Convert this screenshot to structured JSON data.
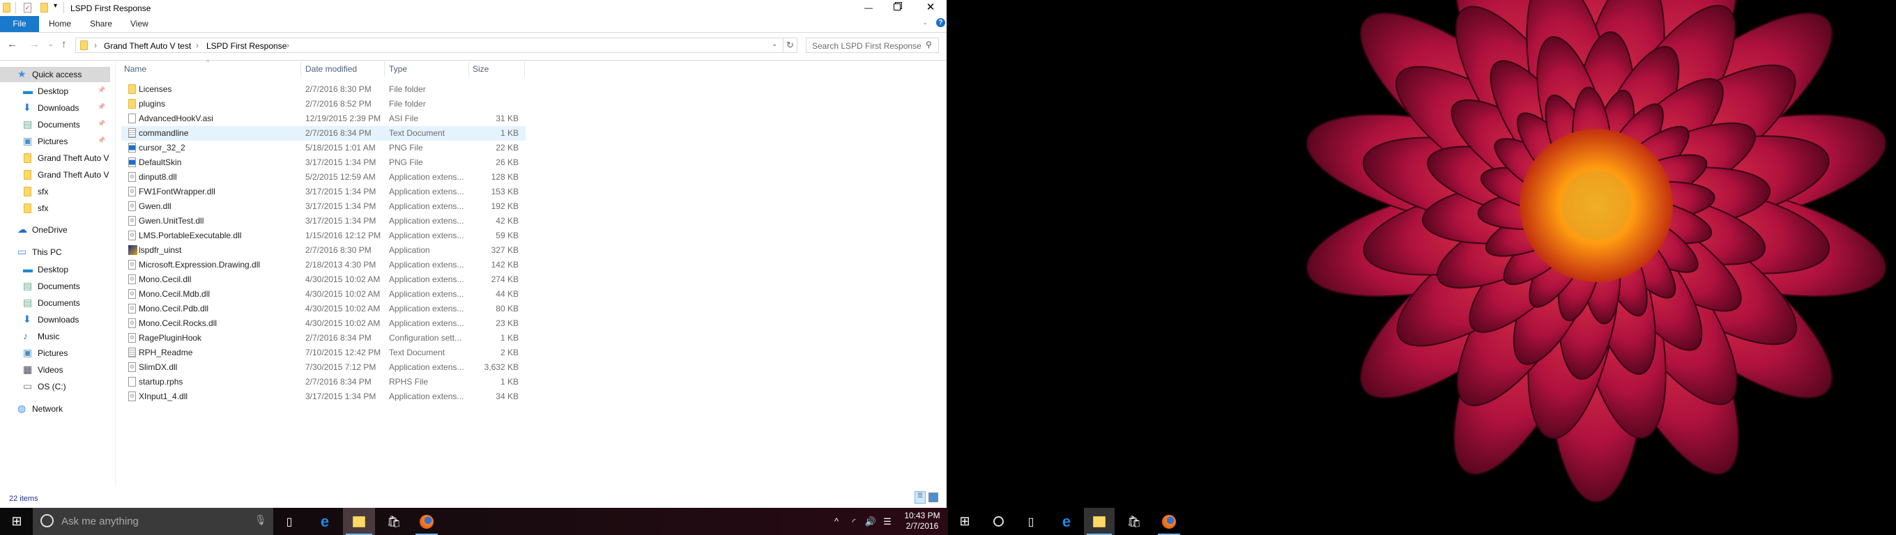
{
  "window": {
    "title": "LSPD First Response"
  },
  "ribbon": {
    "tabs": [
      "File",
      "Home",
      "Share",
      "View"
    ]
  },
  "address": {
    "crumbs": [
      "Grand Theft Auto V test",
      "LSPD First Response"
    ],
    "search_placeholder": "Search LSPD First Response"
  },
  "columns": {
    "name": "Name",
    "date": "Date modified",
    "type": "Type",
    "size": "Size"
  },
  "nav": {
    "quick_access": "Quick access",
    "quick_items": [
      {
        "label": "Desktop",
        "icon": "desktop-icon"
      },
      {
        "label": "Downloads",
        "icon": "download-icon"
      },
      {
        "label": "Documents",
        "icon": "documents-icon"
      },
      {
        "label": "Pictures",
        "icon": "pictures-icon"
      },
      {
        "label": "Grand Theft Auto V",
        "icon": "folder-icon"
      },
      {
        "label": "Grand Theft Auto V",
        "icon": "folder-icon"
      },
      {
        "label": "sfx",
        "icon": "folder-icon"
      },
      {
        "label": "sfx",
        "icon": "folder-icon"
      }
    ],
    "onedrive": "OneDrive",
    "this_pc": "This PC",
    "pc_items": [
      {
        "label": "Desktop",
        "icon": "desktop-icon"
      },
      {
        "label": "Documents",
        "icon": "documents-icon"
      },
      {
        "label": "Documents",
        "icon": "documents-icon"
      },
      {
        "label": "Downloads",
        "icon": "download-icon"
      },
      {
        "label": "Music",
        "icon": "music-icon"
      },
      {
        "label": "Pictures",
        "icon": "pictures-icon"
      },
      {
        "label": "Videos",
        "icon": "videos-icon"
      },
      {
        "label": "OS (C:)",
        "icon": "drive-icon"
      }
    ],
    "network": "Network"
  },
  "files": [
    {
      "name": "Licenses",
      "date": "2/7/2016 8:30 PM",
      "type": "File folder",
      "size": "",
      "icon": "folder"
    },
    {
      "name": "plugins",
      "date": "2/7/2016 8:52 PM",
      "type": "File folder",
      "size": "",
      "icon": "folder"
    },
    {
      "name": "AdvancedHookV.asi",
      "date": "12/19/2015 2:39 PM",
      "type": "ASI File",
      "size": "31 KB",
      "icon": "file"
    },
    {
      "name": "commandline",
      "date": "2/7/2016 8:34 PM",
      "type": "Text Document",
      "size": "1 KB",
      "icon": "text"
    },
    {
      "name": "cursor_32_2",
      "date": "5/18/2015 1:01 AM",
      "type": "PNG File",
      "size": "22 KB",
      "icon": "image"
    },
    {
      "name": "DefaultSkin",
      "date": "3/17/2015 1:34 PM",
      "type": "PNG File",
      "size": "26 KB",
      "icon": "image"
    },
    {
      "name": "dinput8.dll",
      "date": "5/2/2015 12:59 AM",
      "type": "Application extens...",
      "size": "128 KB",
      "icon": "dll"
    },
    {
      "name": "FW1FontWrapper.dll",
      "date": "3/17/2015 1:34 PM",
      "type": "Application extens...",
      "size": "153 KB",
      "icon": "dll"
    },
    {
      "name": "Gwen.dll",
      "date": "3/17/2015 1:34 PM",
      "type": "Application extens...",
      "size": "192 KB",
      "icon": "dll"
    },
    {
      "name": "Gwen.UnitTest.dll",
      "date": "3/17/2015 1:34 PM",
      "type": "Application extens...",
      "size": "42 KB",
      "icon": "dll"
    },
    {
      "name": "LMS.PortableExecutable.dll",
      "date": "1/15/2016 12:12 PM",
      "type": "Application extens...",
      "size": "59 KB",
      "icon": "dll"
    },
    {
      "name": "lspdfr_uinst",
      "date": "2/7/2016 8:30 PM",
      "type": "Application",
      "size": "327 KB",
      "icon": "app"
    },
    {
      "name": "Microsoft.Expression.Drawing.dll",
      "date": "2/18/2013 4:30 PM",
      "type": "Application extens...",
      "size": "142 KB",
      "icon": "dll"
    },
    {
      "name": "Mono.Cecil.dll",
      "date": "4/30/2015 10:02 AM",
      "type": "Application extens...",
      "size": "274 KB",
      "icon": "dll"
    },
    {
      "name": "Mono.Cecil.Mdb.dll",
      "date": "4/30/2015 10:02 AM",
      "type": "Application extens...",
      "size": "44 KB",
      "icon": "dll"
    },
    {
      "name": "Mono.Cecil.Pdb.dll",
      "date": "4/30/2015 10:02 AM",
      "type": "Application extens...",
      "size": "80 KB",
      "icon": "dll"
    },
    {
      "name": "Mono.Cecil.Rocks.dll",
      "date": "4/30/2015 10:02 AM",
      "type": "Application extens...",
      "size": "23 KB",
      "icon": "dll"
    },
    {
      "name": "RagePluginHook",
      "date": "2/7/2016 8:34 PM",
      "type": "Configuration sett...",
      "size": "1 KB",
      "icon": "config"
    },
    {
      "name": "RPH_Readme",
      "date": "7/10/2015 12:42 PM",
      "type": "Text Document",
      "size": "2 KB",
      "icon": "text"
    },
    {
      "name": "SlimDX.dll",
      "date": "7/30/2015 7:12 PM",
      "type": "Application extens...",
      "size": "3,632 KB",
      "icon": "dll"
    },
    {
      "name": "startup.rphs",
      "date": "2/7/2016 8:34 PM",
      "type": "RPHS File",
      "size": "1 KB",
      "icon": "file"
    },
    {
      "name": "XInput1_4.dll",
      "date": "3/17/2015 1:34 PM",
      "type": "Application extens...",
      "size": "34 KB",
      "icon": "dll"
    }
  ],
  "selected_index": 3,
  "status": {
    "count": "22 items"
  },
  "taskbar": {
    "search_placeholder": "Ask me anything",
    "time": "10:43 PM",
    "date": "2/7/2016"
  },
  "colors": {
    "accent": "#1979ca",
    "selection": "#e5f3ff",
    "taskbar": "#0a0508"
  }
}
